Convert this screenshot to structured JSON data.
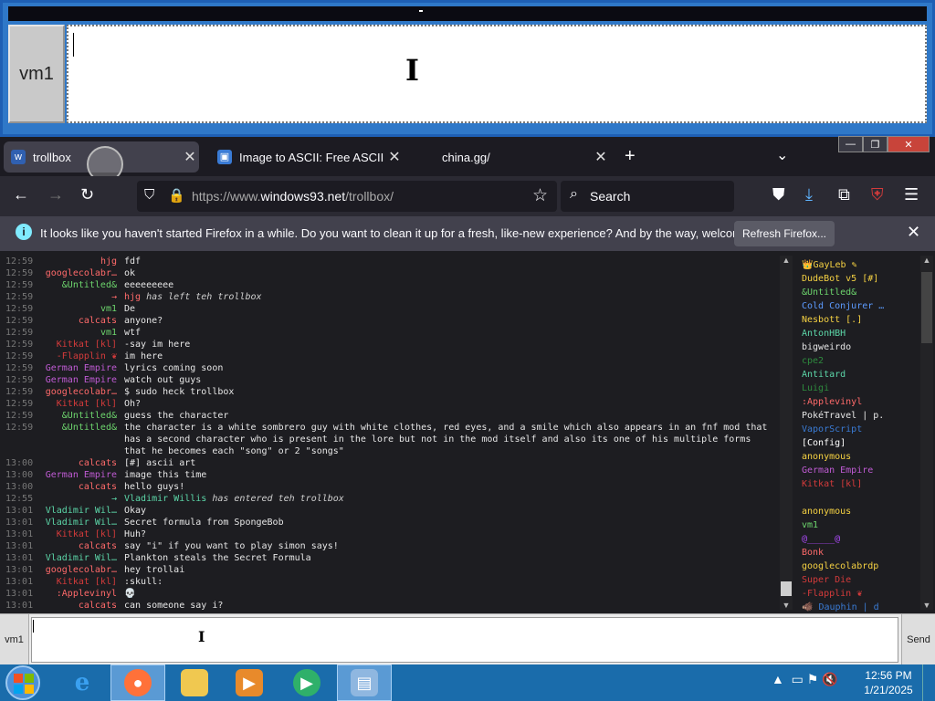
{
  "trollbox_window": {
    "user": "vm1",
    "input_value": ""
  },
  "tabs": [
    {
      "label": "trollbox",
      "favicon": "w93-icon",
      "active": true
    },
    {
      "label": "Image to ASCII: Free ASCII Art C",
      "favicon": "page-icon",
      "active": false
    },
    {
      "label": "china.gg/",
      "favicon": "",
      "active": false
    }
  ],
  "nav": {
    "url_prefix": "https://www.",
    "url_domain": "windows93.net",
    "url_path": "/trollbox/",
    "search_placeholder": "Search"
  },
  "notification": {
    "message": "It looks like you haven't started Firefox in a while. Do you want to clean it up for a fresh, like-new experience? And by the way, welcome back!",
    "button": "Refresh Firefox..."
  },
  "chat": [
    {
      "time": "12:59",
      "nick": "hjg",
      "color": "#ff6a6a",
      "msg": "fdf"
    },
    {
      "time": "12:59",
      "nick": "googlecolabr…",
      "color": "#ff6a6a",
      "msg": "ok"
    },
    {
      "time": "12:59",
      "nick": "&Untitled&",
      "color": "#6dd56d",
      "msg": "eeeeeeeee"
    },
    {
      "time": "12:59",
      "nick": "→",
      "color": "#ff6a6a",
      "msg": "hjg has left teh trollbox",
      "system": true,
      "sysnick": "hjg",
      "sysrest": " has left teh trollbox"
    },
    {
      "time": "12:59",
      "nick": "vm1",
      "color": "#6dd56d",
      "msg": "De"
    },
    {
      "time": "12:59",
      "nick": "calcats",
      "color": "#ff6a6a",
      "msg": "anyone?"
    },
    {
      "time": "12:59",
      "nick": "vm1",
      "color": "#6dd56d",
      "msg": "wtf"
    },
    {
      "time": "12:59",
      "nick": "Kitkat [kl]",
      "color": "#d43b3b",
      "msg": "-say im here"
    },
    {
      "time": "12:59",
      "nick": "-Flapplin ❦",
      "color": "#d43b3b",
      "msg": "im here"
    },
    {
      "time": "12:59",
      "nick": "German Empire",
      "color": "#c05bd4",
      "msg": "lyrics coming soon"
    },
    {
      "time": "12:59",
      "nick": "German Empire",
      "color": "#c05bd4",
      "msg": "watch out guys"
    },
    {
      "time": "12:59",
      "nick": "googlecolabr…",
      "color": "#ff6a6a",
      "msg": "$ sudo heck trollbox"
    },
    {
      "time": "12:59",
      "nick": "Kitkat [kl]",
      "color": "#d43b3b",
      "msg": "Oh?"
    },
    {
      "time": "12:59",
      "nick": "&Untitled&",
      "color": "#6dd56d",
      "msg": "guess the character"
    },
    {
      "time": "12:59",
      "nick": "&Untitled&",
      "color": "#6dd56d",
      "msg": "the character is a white sombrero guy with white clothes, red eyes, and a smile which also appears in an fnf mod that has a second character who is present in the lore but not in the mod itself and also its one of his multiple forms that he becomes each \"song\" or 2 \"songs\""
    },
    {
      "time": "13:00",
      "nick": "calcats",
      "color": "#ff6a6a",
      "msg": "[#] ascii art"
    },
    {
      "time": "13:00",
      "nick": "German Empire",
      "color": "#c05bd4",
      "msg": "image this time"
    },
    {
      "time": "13:00",
      "nick": "calcats",
      "color": "#ff6a6a",
      "msg": "hello guys!"
    },
    {
      "time": "12:55",
      "nick": "→",
      "color": "#5cd6a8",
      "msg": "Vladimir Willis has entered teh trollbox",
      "system": true,
      "sysnick": "Vladimir Willis",
      "sysrest": " has entered teh trollbox"
    },
    {
      "time": "13:01",
      "nick": "Vladimir Wil…",
      "color": "#5cd6a8",
      "msg": "Okay"
    },
    {
      "time": "13:01",
      "nick": "Vladimir Wil…",
      "color": "#5cd6a8",
      "msg": "Secret formula from SpongeBob"
    },
    {
      "time": "13:01",
      "nick": "Kitkat [kl]",
      "color": "#d43b3b",
      "msg": "Huh?"
    },
    {
      "time": "13:01",
      "nick": "calcats",
      "color": "#ff6a6a",
      "msg": "say \"i\" if you want to play simon says!"
    },
    {
      "time": "13:01",
      "nick": "Vladimir Wil…",
      "color": "#5cd6a8",
      "msg": "Plankton steals the Secret Formula"
    },
    {
      "time": "13:01",
      "nick": "googlecolabr…",
      "color": "#ff6a6a",
      "msg": "hey trollai"
    },
    {
      "time": "13:01",
      "nick": "Kitkat [kl]",
      "color": "#d43b3b",
      "msg": ":skull:"
    },
    {
      "time": "13:01",
      "nick": ":Applevinyl",
      "color": "#ff6a6a",
      "msg": "💀"
    },
    {
      "time": "13:01",
      "nick": "calcats",
      "color": "#ff6a6a",
      "msg": "can someone say i?"
    }
  ],
  "users": [
    {
      "name": "👑GayLeb ✎",
      "color": "#f5d142"
    },
    {
      "name": "DudeBot v5 [#]",
      "color": "#f5d142"
    },
    {
      "name": "&Untitled&",
      "color": "#6dd56d"
    },
    {
      "name": "Cold Conjurer …",
      "color": "#5c9bff"
    },
    {
      "name": "Nesbott [.]",
      "color": "#f5d142"
    },
    {
      "name": "AntonHBH",
      "color": "#5cd6a8"
    },
    {
      "name": "bigweirdo",
      "color": "#e6e6e6"
    },
    {
      "name": "cpe2",
      "color": "#2e8b3e"
    },
    {
      "name": "Antitard",
      "color": "#5cd6a8"
    },
    {
      "name": "Luigi",
      "color": "#2e8b3e"
    },
    {
      "name": ":Applevinyl",
      "color": "#ff6a6a"
    },
    {
      "name": "PokéTravel | p.",
      "color": "#e6e6e6"
    },
    {
      "name": "VaporScript",
      "color": "#3a7bd5"
    },
    {
      "name": "[Config]",
      "color": "#ffffff"
    },
    {
      "name": "anonymous",
      "color": "#f5d142"
    },
    {
      "name": "German Empire",
      "color": "#c05bd4"
    },
    {
      "name": "Kitkat [kl]",
      "color": "#d43b3b"
    },
    {
      "name": "",
      "color": "#8a1f1f"
    },
    {
      "name": "anonymous",
      "color": "#f5d142"
    },
    {
      "name": "vm1",
      "color": "#6dd56d"
    },
    {
      "name": "@_____@",
      "color": "#b04bff"
    },
    {
      "name": "Bonk",
      "color": "#ff6a6a"
    },
    {
      "name": "googlecolabrdp",
      "color": "#f5d142"
    },
    {
      "name": "Super Die",
      "color": "#d43b3b"
    },
    {
      "name": "-Flapplin ❦",
      "color": "#d43b3b"
    },
    {
      "name": "🐗 Dauphin | d",
      "color": "#3a7bd5"
    }
  ],
  "bottom": {
    "user": "vm1",
    "input_value": "",
    "send": "Send"
  },
  "taskbar": {
    "time": "12:56 PM",
    "date": "1/21/2025"
  },
  "colors": {
    "accent": "#2f78c8",
    "taskbar": "#1a6cab",
    "firefox_dark": "#2b2a33"
  }
}
